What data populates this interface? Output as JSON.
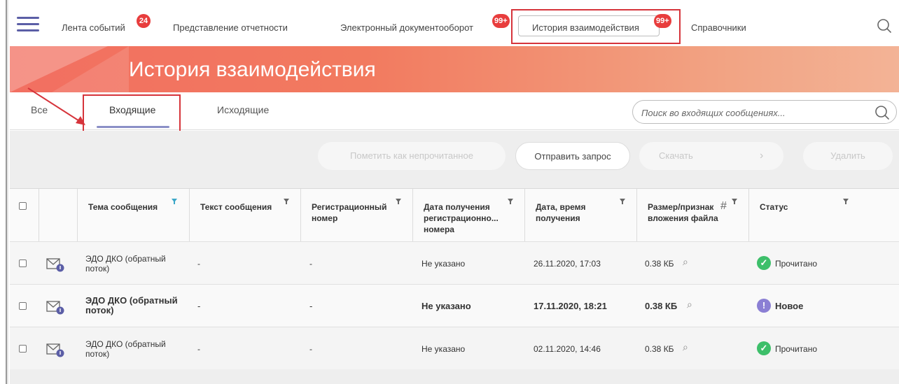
{
  "nav": {
    "items": [
      {
        "label": "Лента событий",
        "badge": "24"
      },
      {
        "label": "Представление отчетности"
      },
      {
        "label": "Электронный документооборот",
        "badge": "99+"
      },
      {
        "label": "История взаимодействия",
        "badge": "99+"
      },
      {
        "label": "Справочники"
      }
    ],
    "menu_icon": "hamburger-icon",
    "search_icon": "search-icon"
  },
  "banner": {
    "title": "История взаимодействия"
  },
  "tabs": {
    "items": [
      "Все",
      "Входящие",
      "Исходящие"
    ],
    "active": "Входящие"
  },
  "search": {
    "placeholder": "Поиск во входящих сообщениях..."
  },
  "toolbar": {
    "mark_unread": "Пометить как непрочитанное",
    "send_request": "Отправить запрос",
    "download": "Скачать",
    "delete": "Удалить"
  },
  "table": {
    "headers": [
      "Тема сообщения",
      "Текст сообщения",
      "Регистрационный номер",
      "Дата получения регистрационно... номера",
      "Дата, время получения",
      "Размер/признак вложения файла",
      "Статус"
    ],
    "rows": [
      {
        "subject": "ЭДО ДКО (обратный поток)",
        "text": "-",
        "reg_number": "-",
        "reg_date": "Не указано",
        "received": "26.11.2020, 17:03",
        "size": "0.38 КБ",
        "status": "Прочитано"
      },
      {
        "subject": "ЭДО ДКО (обратный поток)",
        "text": "-",
        "reg_number": "-",
        "reg_date": "Не указано",
        "received": "17.11.2020, 18:21",
        "size": "0.38 КБ",
        "status": "Новое"
      },
      {
        "subject": "ЭДО ДКО (обратный поток)",
        "text": "-",
        "reg_number": "-",
        "reg_date": "Не указано",
        "received": "02.11.2020, 14:46",
        "size": "0.38 КБ",
        "status": "Прочитано"
      }
    ]
  },
  "stray_mark": "#",
  "colors": {
    "accent": "#5b5ea6",
    "badge": "#e83d3d",
    "highlight": "#d6343b",
    "status_read": "#3dbf6a",
    "status_new": "#8b7fd4",
    "filter": "#3ca7c8"
  }
}
